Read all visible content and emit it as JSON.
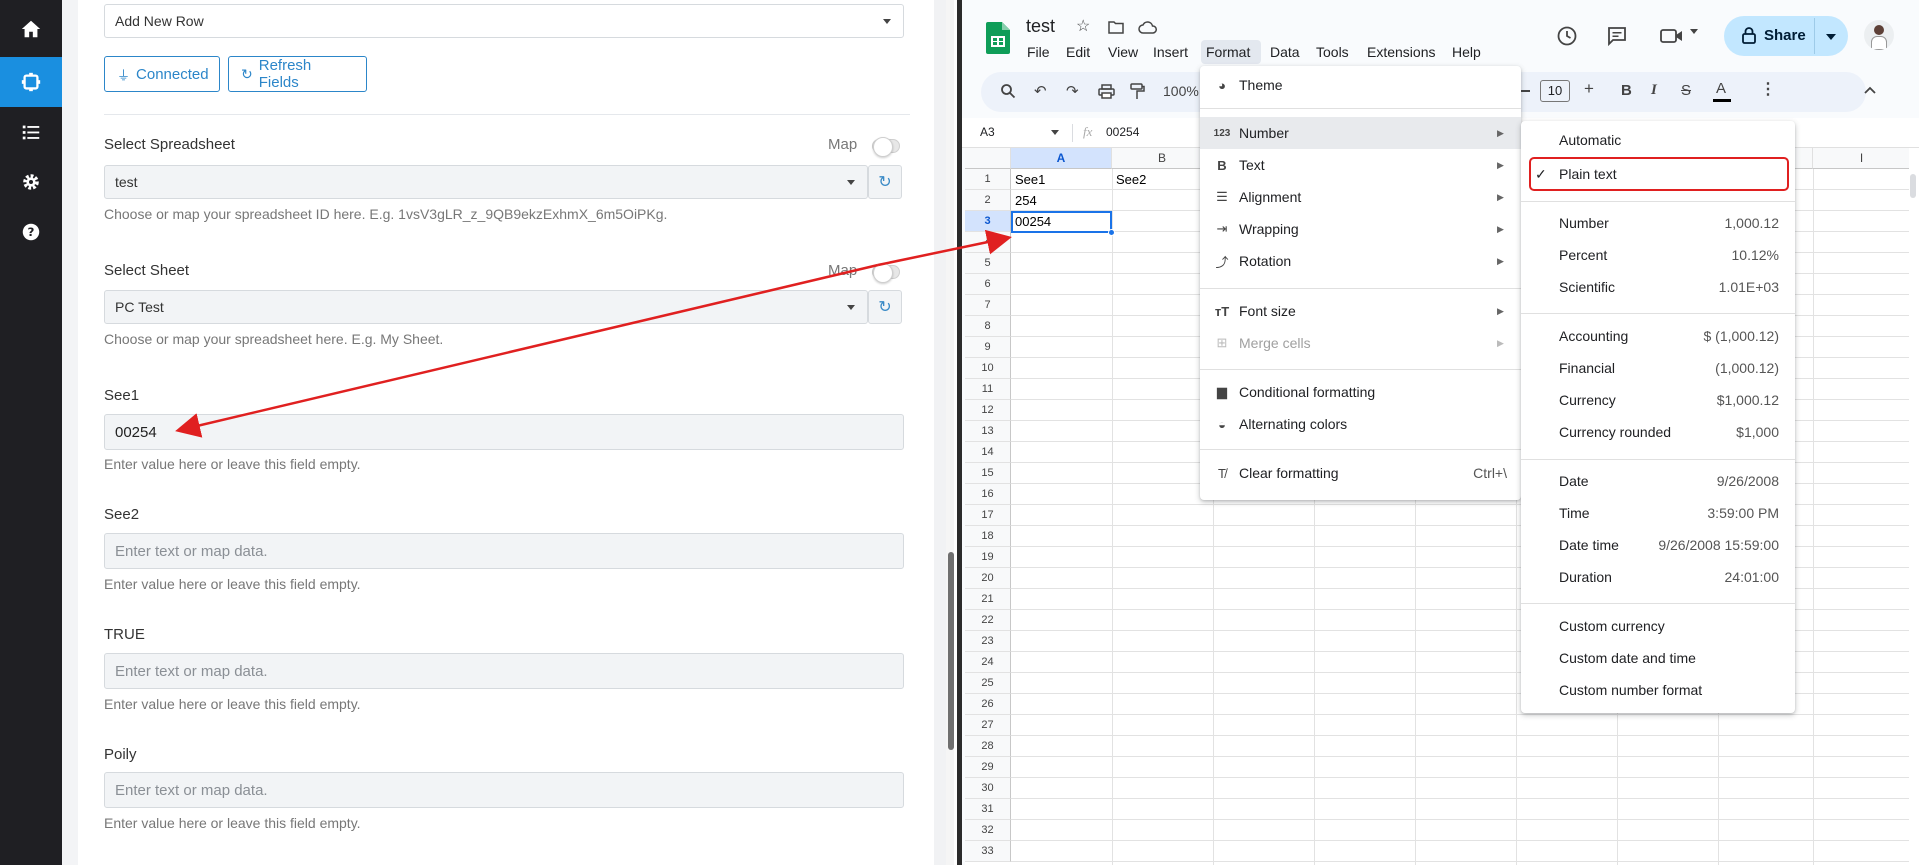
{
  "left_app": {
    "rail_icons": [
      "home-icon",
      "integration-icon",
      "tasks-icon",
      "settings-icon",
      "help-icon"
    ],
    "action_select": "Add New Row",
    "connected_button": "Connected",
    "refresh_fields_button": "Refresh Fields",
    "spreadsheet": {
      "label": "Select Spreadsheet",
      "map_label": "Map",
      "value": "test",
      "help": "Choose or map your spreadsheet ID here. E.g. 1vsV3gLR_z_9QB9ekzExhmX_6m5OiPKg."
    },
    "sheet": {
      "label": "Select Sheet",
      "map_label": "Map",
      "value": "PC Test",
      "help": "Choose or map your spreadsheet here. E.g. My Sheet."
    },
    "fields": [
      {
        "label": "See1",
        "value": "00254",
        "placeholder": "Enter text or map data.",
        "help": "Enter value here or leave this field empty."
      },
      {
        "label": "See2",
        "value": "",
        "placeholder": "Enter text or map data.",
        "help": "Enter value here or leave this field empty."
      },
      {
        "label": "TRUE",
        "value": "",
        "placeholder": "Enter text or map data.",
        "help": "Enter value here or leave this field empty."
      },
      {
        "label": "Poily",
        "value": "",
        "placeholder": "Enter text or map data.",
        "help": "Enter value here or leave this field empty."
      }
    ]
  },
  "sheets": {
    "doc_title": "test",
    "menu": [
      "File",
      "Edit",
      "View",
      "Insert",
      "Format",
      "Data",
      "Tools",
      "Extensions",
      "Help"
    ],
    "share_label": "Share",
    "zoom": "100%",
    "font_size": "10",
    "name_box": "A3",
    "formula_value": "00254",
    "columns": [
      "A",
      "B",
      "I"
    ],
    "rows": [
      "1",
      "2",
      "3",
      "4",
      "5",
      "6",
      "7",
      "8",
      "9",
      "10",
      "11",
      "12",
      "13",
      "14",
      "15",
      "16",
      "17",
      "18",
      "19",
      "20",
      "21",
      "22",
      "23",
      "24",
      "25",
      "26",
      "27",
      "28",
      "29",
      "30",
      "31",
      "32",
      "33"
    ],
    "cells": {
      "A1": "See1",
      "B1": "See2",
      "A2": "254",
      "A3": "00254"
    },
    "format_menu": {
      "theme": "Theme",
      "number": "Number",
      "text": "Text",
      "alignment": "Alignment",
      "wrapping": "Wrapping",
      "rotation": "Rotation",
      "font_size": "Font size",
      "merge_cells": "Merge cells",
      "conditional_formatting": "Conditional formatting",
      "alternating_colors": "Alternating colors",
      "clear_formatting": "Clear formatting",
      "clear_shortcut": "Ctrl+\\"
    },
    "number_submenu": [
      {
        "label": "Automatic",
        "value": ""
      },
      {
        "label": "Plain text",
        "value": "",
        "checked": true
      },
      {
        "label": "Number",
        "value": "1,000.12"
      },
      {
        "label": "Percent",
        "value": "10.12%"
      },
      {
        "label": "Scientific",
        "value": "1.01E+03"
      },
      {
        "label": "Accounting",
        "value": "$ (1,000.12)"
      },
      {
        "label": "Financial",
        "value": "(1,000.12)"
      },
      {
        "label": "Currency",
        "value": "$1,000.12"
      },
      {
        "label": "Currency rounded",
        "value": "$1,000"
      },
      {
        "label": "Date",
        "value": "9/26/2008"
      },
      {
        "label": "Time",
        "value": "3:59:00 PM"
      },
      {
        "label": "Date time",
        "value": "9/26/2008 15:59:00"
      },
      {
        "label": "Duration",
        "value": "24:01:00"
      },
      {
        "label": "Custom currency",
        "value": ""
      },
      {
        "label": "Custom date and time",
        "value": ""
      },
      {
        "label": "Custom number format",
        "value": ""
      }
    ]
  },
  "colors": {
    "accent_blue": "#2c86c9",
    "annotation_red": "#e02020",
    "sheets_green": "#0f9d58"
  }
}
